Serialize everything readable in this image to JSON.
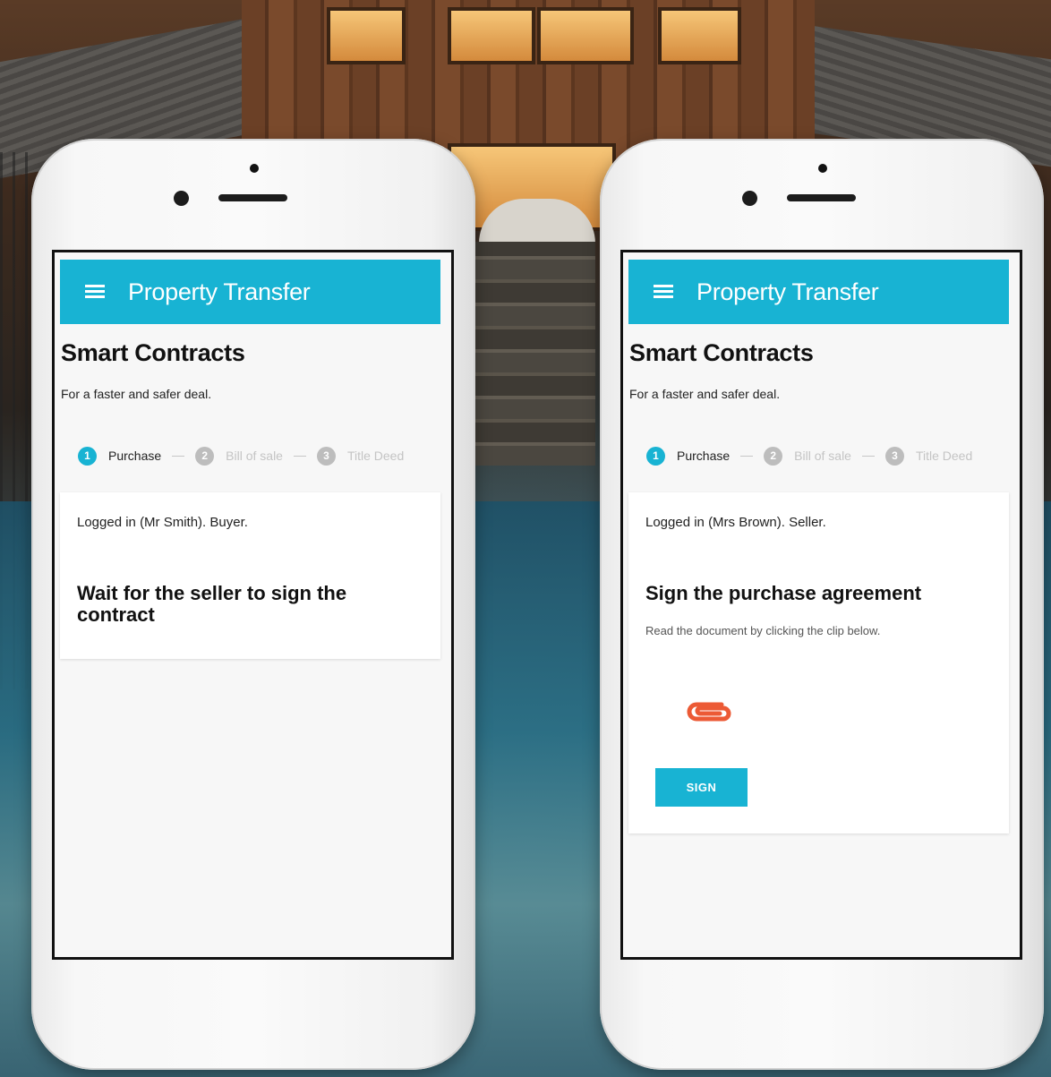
{
  "phones": [
    {
      "appbar": {
        "title": "Property Transfer",
        "menu_icon": "hamburger-menu-icon"
      },
      "header": {
        "title": "Smart Contracts",
        "subtitle": "For a faster and safer deal."
      },
      "stepper": {
        "steps": [
          {
            "number": "1",
            "label": "Purchase",
            "state": "active"
          },
          {
            "number": "2",
            "label": "Bill of sale",
            "state": "inactive"
          },
          {
            "number": "3",
            "label": "Title Deed",
            "state": "inactive"
          }
        ]
      },
      "card": {
        "login_status": "Logged in (Mr Smith). Buyer.",
        "heading": "Wait for the seller to sign the contract"
      }
    },
    {
      "appbar": {
        "title": "Property Transfer",
        "menu_icon": "hamburger-menu-icon"
      },
      "header": {
        "title": "Smart Contracts",
        "subtitle": "For a faster and safer deal."
      },
      "stepper": {
        "steps": [
          {
            "number": "1",
            "label": "Purchase",
            "state": "active"
          },
          {
            "number": "2",
            "label": "Bill of sale",
            "state": "inactive"
          },
          {
            "number": "3",
            "label": "Title Deed",
            "state": "inactive"
          }
        ]
      },
      "card": {
        "login_status": "Logged in (Mrs Brown). Seller.",
        "heading": "Sign the purchase agreement",
        "hint": "Read the document by clicking the clip below.",
        "attachment_icon": "paperclip-icon",
        "button_label": "SIGN"
      }
    }
  ],
  "colors": {
    "accent": "#18b3d3",
    "clip": "#ec5a35"
  }
}
